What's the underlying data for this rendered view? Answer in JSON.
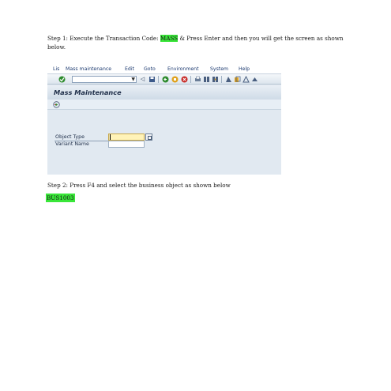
{
  "step1": {
    "before": "Step 1: Execute the Transaction Code: ",
    "code": "MASS",
    "after": " & Press Enter and then you will get the screen as shown below."
  },
  "sap": {
    "menu": [
      "Lis",
      "Mass maintenance",
      "Edit",
      "Goto",
      "Environment",
      "System",
      "Help"
    ],
    "title": "Mass Maintenance",
    "fields": {
      "object_type_label": "Object Type",
      "variant_name_label": "Variant Name"
    },
    "colors": {
      "required_input": "#fff3b8",
      "background": "#dfe8f0"
    },
    "icons": {
      "enter": "green-check-icon",
      "save": "save-icon",
      "back": "back-icon",
      "exit": "exit-icon",
      "cancel": "cancel-icon",
      "print": "print-icon",
      "find": "find-icon",
      "find_next": "find-next-icon",
      "first_page": "first-page-icon",
      "execute": "execute-icon",
      "f4_help": "f4-help-icon"
    }
  },
  "step2": {
    "text": "Step 2: Press F4 and select the business object as shown below"
  },
  "bus_code": "BUS1003",
  "highlight_color": "#39e639"
}
